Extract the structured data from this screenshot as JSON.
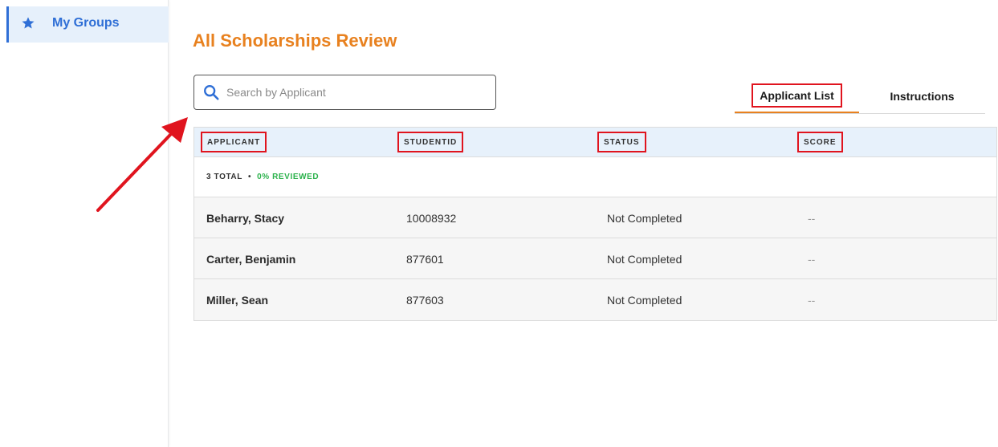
{
  "sidebar": {
    "items": [
      {
        "label": "My Groups",
        "icon": "star-icon",
        "active": true
      }
    ]
  },
  "page": {
    "title": "All Scholarships Review"
  },
  "search": {
    "placeholder": "Search by Applicant",
    "value": ""
  },
  "tabs": [
    {
      "label": "Applicant List",
      "active": true
    },
    {
      "label": "Instructions",
      "active": false
    }
  ],
  "table": {
    "columns": [
      "APPLICANT",
      "STUDENTID",
      "STATUS",
      "SCORE"
    ],
    "summary": {
      "total": "3 TOTAL",
      "separator": "•",
      "reviewed": "0% REVIEWED"
    },
    "rows": [
      {
        "applicant": "Beharry, Stacy",
        "student_id": "10008932",
        "status": "Not Completed",
        "score": "--"
      },
      {
        "applicant": "Carter, Benjamin",
        "student_id": "877601",
        "status": "Not Completed",
        "score": "--"
      },
      {
        "applicant": "Miller, Sean",
        "student_id": "877603",
        "status": "Not Completed",
        "score": "--"
      }
    ]
  },
  "colors": {
    "accent": "#e8811f",
    "primary": "#2f6fd6",
    "highlight": "#e0141e",
    "reviewed": "#2bb24c"
  }
}
